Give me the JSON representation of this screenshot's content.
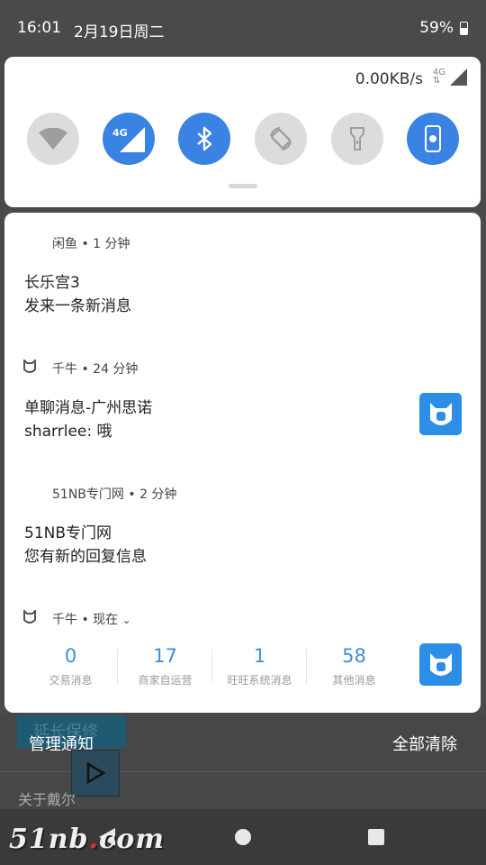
{
  "status_bar": {
    "time": "16:01",
    "date": "2月19日周二",
    "battery": "59%",
    "battery_level": 0.59
  },
  "quick_settings": {
    "net_speed": "0.00KB/s",
    "network_type": "4G",
    "tiles": [
      {
        "icon": "wifi-icon",
        "active": false
      },
      {
        "icon": "mobile-data-4g-icon",
        "label": "4G",
        "active": true
      },
      {
        "icon": "bluetooth-icon",
        "active": true
      },
      {
        "icon": "auto-rotate-icon",
        "active": false
      },
      {
        "icon": "flashlight-icon",
        "active": false
      },
      {
        "icon": "screen-record-icon",
        "active": true
      }
    ]
  },
  "notifications": [
    {
      "app": "闲鱼",
      "time": "1 分钟",
      "title": "长乐宫3",
      "text": "发来一条新消息"
    },
    {
      "app": "千牛",
      "time": "24 分钟",
      "title": "单聊消息-广州思诺",
      "text": "sharrlee: 哦"
    },
    {
      "app": "51NB专门网",
      "time": "2 分钟",
      "title": "51NB专门网",
      "text": "您有新的回复信息"
    },
    {
      "app": "千牛",
      "time": "现在",
      "stats": [
        {
          "value": "0",
          "label": "交易消息"
        },
        {
          "value": "17",
          "label": "商家自运营"
        },
        {
          "value": "1",
          "label": "旺旺系统消息"
        },
        {
          "value": "58",
          "label": "其他消息"
        }
      ]
    }
  ],
  "footer": {
    "manage": "管理通知",
    "clear_all": "全部清除"
  },
  "background": {
    "button_text": "延长保修",
    "about_text": "关于戴尔"
  },
  "watermark": {
    "text": "51nb",
    "dot": ".",
    "suffix": "com"
  },
  "colors": {
    "accent": "#3b83e3",
    "tile_off": "#dcdcdc",
    "stat_number": "#3d8fd6"
  }
}
